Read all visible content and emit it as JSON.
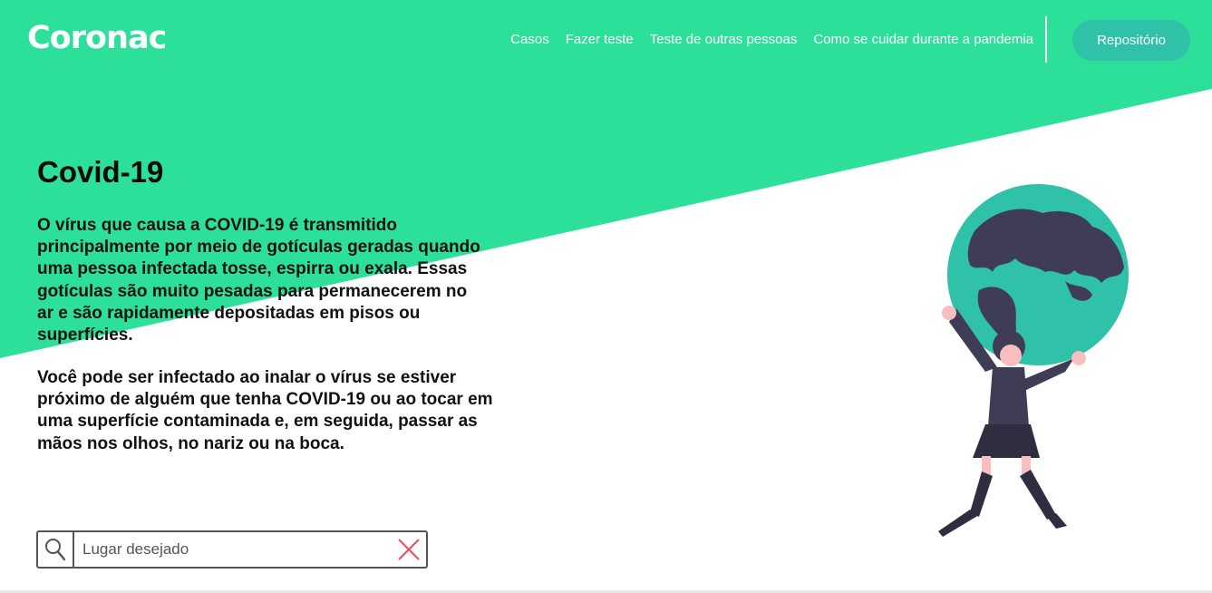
{
  "brand": {
    "name": "Coronac",
    "color": "#2ce09a",
    "button_color": "#2fc2a8"
  },
  "nav": {
    "items": [
      {
        "label": "Casos"
      },
      {
        "label": "Fazer teste"
      },
      {
        "label": "Teste de outras pessoas"
      },
      {
        "label": "Como se cuidar durante a pandemia"
      }
    ],
    "repo_button": "Repositório"
  },
  "main": {
    "title": "Covid-19",
    "paragraph1": "O vírus que causa a COVID-19 é transmitido principalmente por meio de gotículas geradas quando uma pessoa infectada tosse, espirra ou exala. Essas gotículas são muito pesadas para permanecerem no ar e são rapidamente depositadas em pisos ou superfícies.",
    "paragraph2": "Você pode ser infectado ao inalar o vírus se estiver próximo de alguém que tenha COVID-19 ou ao tocar em uma superfície contaminada e, em seguida, passar as mãos nos olhos, no nariz ou na boca."
  },
  "search": {
    "placeholder": "Lugar desejado",
    "value": ""
  },
  "icons": {
    "search": "search-icon",
    "clear": "close-icon",
    "illustration": "woman-holding-globe"
  }
}
